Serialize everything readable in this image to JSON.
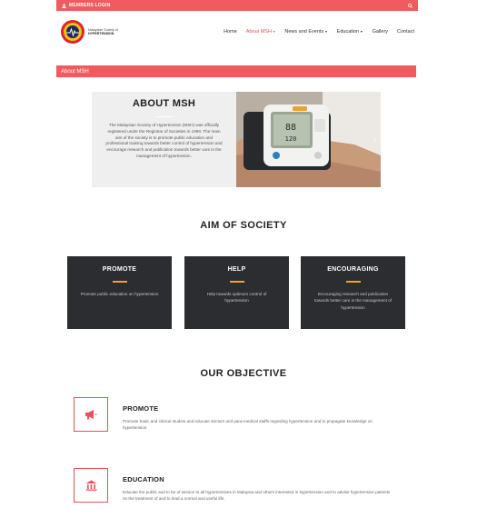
{
  "topbar": {
    "login_label": "MEMBERS LOGIN"
  },
  "logo": {
    "line1": "Malaysian Society of",
    "line2": "HYPERTENSION"
  },
  "nav": {
    "home": "Home",
    "about": "About MSH",
    "news": "News and Events",
    "education": "Education",
    "gallery": "Gallery",
    "contact": "Contact"
  },
  "banner": {
    "title": "About MSH"
  },
  "about": {
    "title": "ABOUT MSH",
    "description": "The Malaysian Society of Hypertension (MSH) was officially registered under the Registrar of Societies in 1998. The main aim of the society is to promote public education and professional training towards better control of hypertension and encourage research and publication towards better care in the management of hypertension."
  },
  "aim": {
    "title": "AIM OF SOCIETY",
    "cards": [
      {
        "title": "PROMOTE",
        "text": "Promote public education on hypertension"
      },
      {
        "title": "HELP",
        "text": "Help towards optimum control of hypertension"
      },
      {
        "title": "ENCOURAGING",
        "text": "Encouraging research and publication towards better care in the management of hypertension"
      }
    ]
  },
  "objective": {
    "title": "OUR OBJECTIVE",
    "items": [
      {
        "title": "PROMOTE",
        "text": "Promote basic and clinical studies and educate doctors and para-medical staffs regarding hypertension and to propagate knowledge on hypertension."
      },
      {
        "title": "EDUCATION",
        "text": "Educate the public and to be of service to all hypertensives in Malaysia and others interested in hypertension and to advise hypertensive patients on the treatment of and to lead a normal and useful life."
      }
    ]
  },
  "colors": {
    "accent": "#ef5b5e",
    "card_bg": "#2b2d30",
    "card_line": "#f2a22c"
  },
  "icons": {
    "login": "user-icon",
    "search": "search-icon",
    "promote": "megaphone-icon",
    "education": "institution-icon",
    "slider_next": "chevron-right-icon"
  }
}
